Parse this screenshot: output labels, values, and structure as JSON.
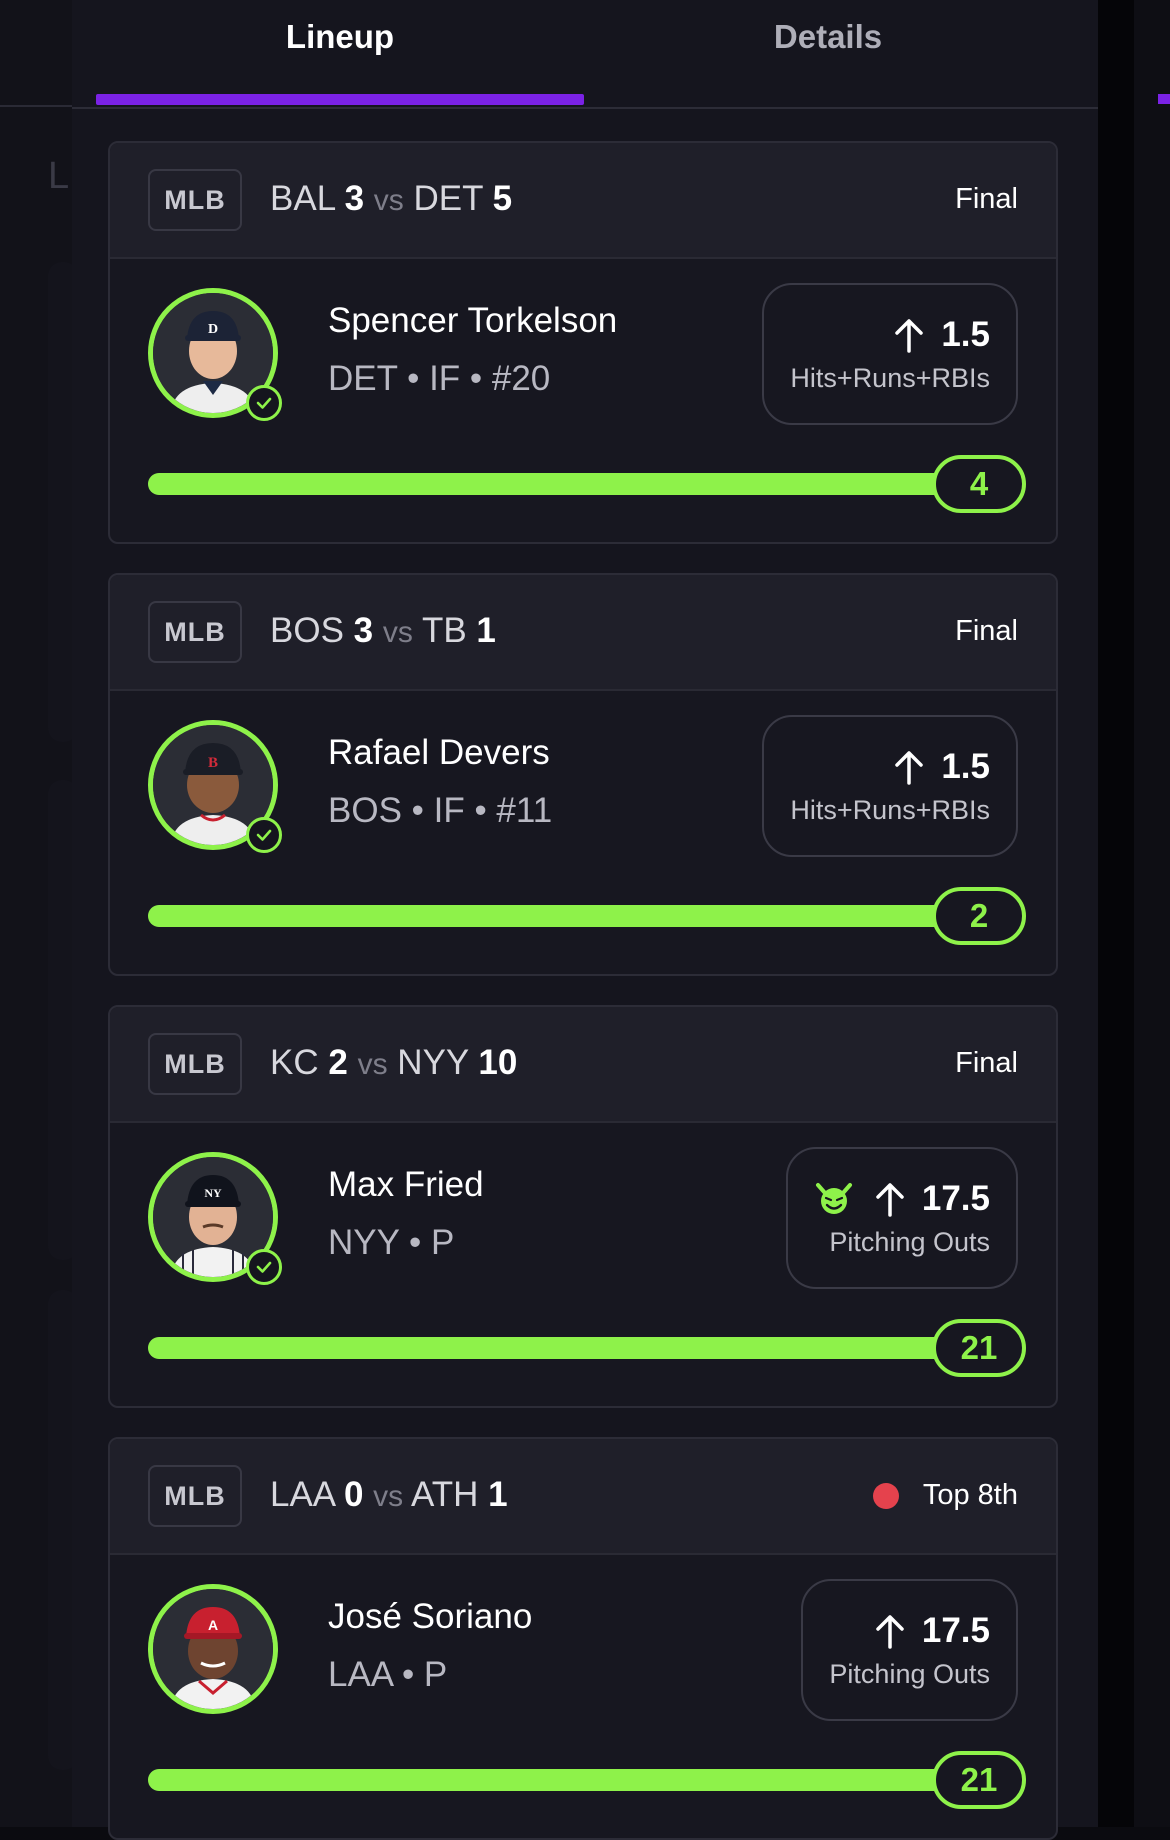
{
  "tabs": [
    {
      "label": "Lineup",
      "active": true
    },
    {
      "label": "Details",
      "active": false
    }
  ],
  "colors": {
    "accent": "#7b22e6",
    "success": "#8ef24a",
    "live": "#e5424d"
  },
  "picks": [
    {
      "league": "MLB",
      "home_team": "BAL",
      "home_score": "3",
      "vs": "vs",
      "away_team": "DET",
      "away_score": "5",
      "status": "Final",
      "live": false,
      "player_name": "Spencer Torkelson",
      "player_meta": "DET • IF • #20",
      "cap_logo": "D",
      "line": "1.5",
      "direction": "up-arrow-icon",
      "stat": "Hits+Runs+RBIs",
      "result": "4",
      "progress": 1.0
    },
    {
      "league": "MLB",
      "home_team": "BOS",
      "home_score": "3",
      "vs": "vs",
      "away_team": "TB",
      "away_score": "1",
      "status": "Final",
      "live": false,
      "player_name": "Rafael Devers",
      "player_meta": "BOS • IF • #11",
      "cap_logo": "B",
      "line": "1.5",
      "direction": "up-arrow-icon",
      "stat": "Hits+Runs+RBIs",
      "result": "2",
      "progress": 1.0
    },
    {
      "league": "MLB",
      "home_team": "KC",
      "home_score": "2",
      "vs": "vs",
      "away_team": "NYY",
      "away_score": "10",
      "status": "Final",
      "live": false,
      "player_name": "Max Fried",
      "player_meta": "NYY • P",
      "cap_logo": "NY",
      "line": "17.5",
      "direction": "up-arrow-icon",
      "stat": "Pitching Outs",
      "badge_icon": "demon-icon",
      "result": "21",
      "progress": 1.0
    },
    {
      "league": "MLB",
      "home_team": "LAA",
      "home_score": "0",
      "vs": "vs",
      "away_team": "ATH",
      "away_score": "1",
      "status": "Top 8th",
      "live": true,
      "player_name": "José Soriano",
      "player_meta": "LAA • P",
      "cap_logo": "A",
      "line": "17.5",
      "direction": "up-arrow-icon",
      "stat": "Pitching Outs",
      "result": "21",
      "progress": 1.0
    }
  ]
}
